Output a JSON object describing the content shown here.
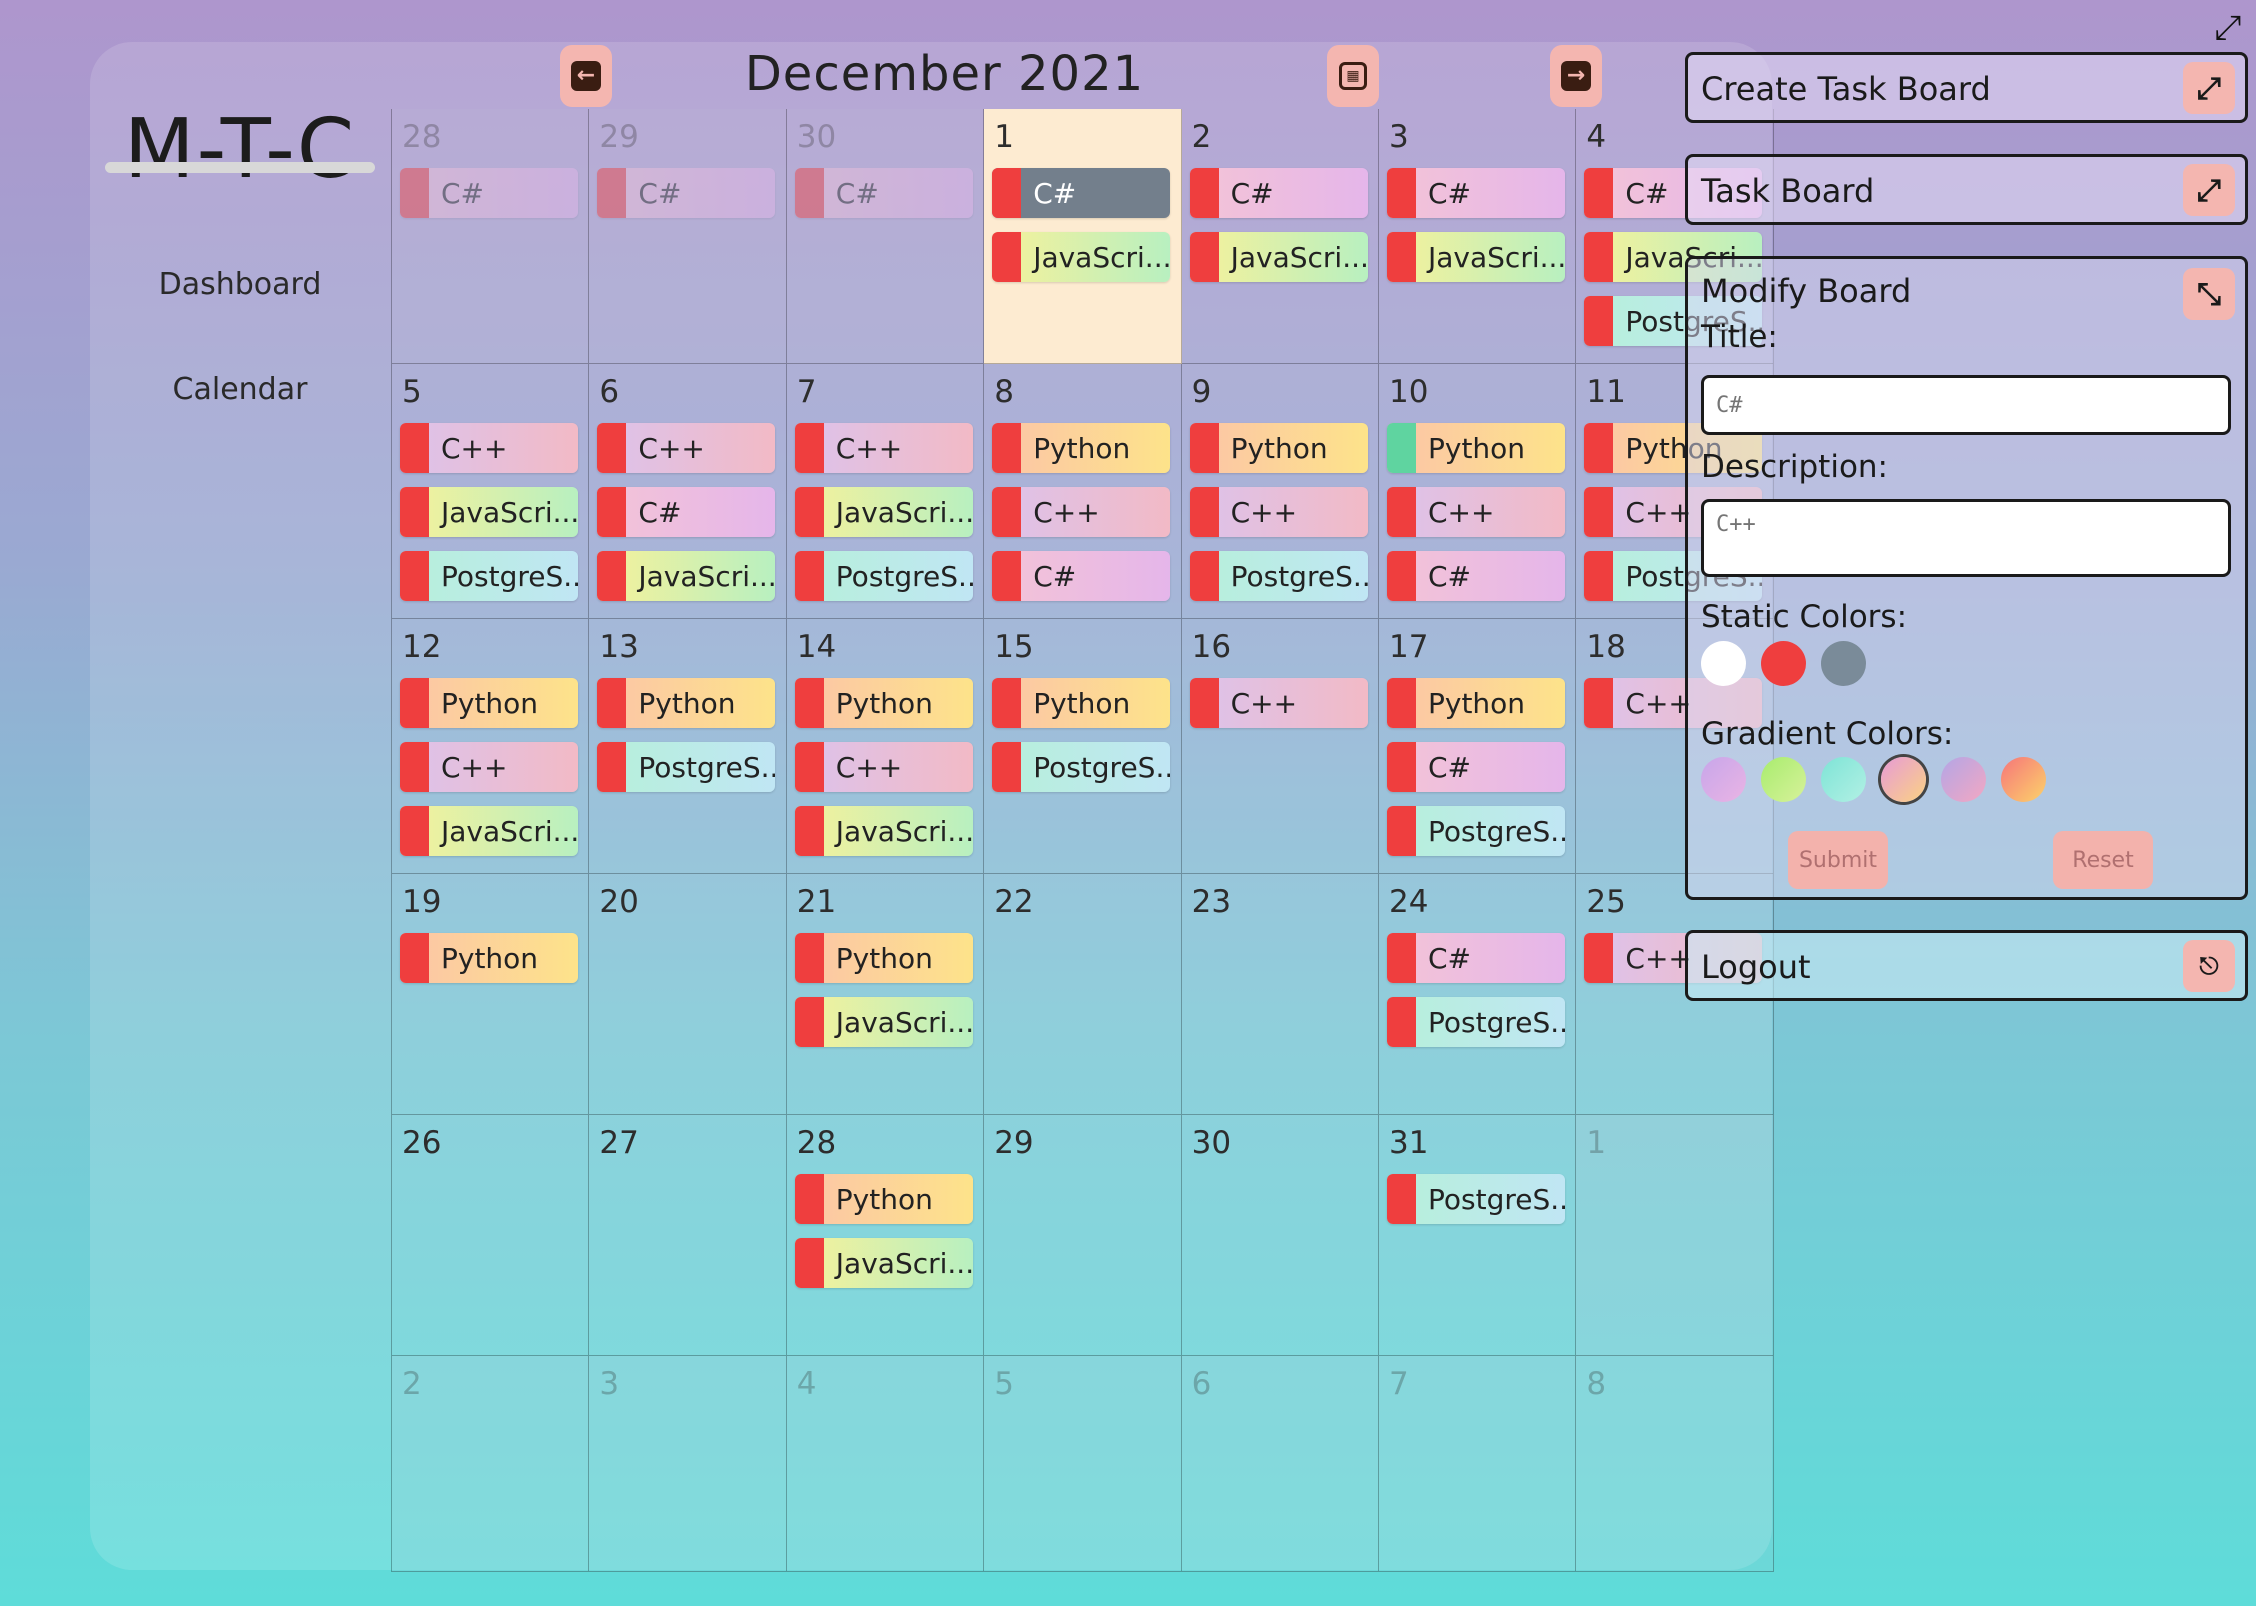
{
  "app": {
    "logo": "M-T-C"
  },
  "nav": {
    "dashboard": "Dashboard",
    "calendar": "Calendar"
  },
  "header": {
    "month": "December 2021",
    "prev_icon": "arrow-left-icon",
    "today_icon": "calendar-icon",
    "next_icon": "arrow-right-icon"
  },
  "colors": {
    "red": "#ef3e3e",
    "green": "#5fd4a0",
    "csharp": "#e7b6e4",
    "javascript": "#c9f0a6",
    "postgres": "#a9ece6",
    "cpp": "#ecc0d4",
    "python": "#fcd98f",
    "today": "#fdebd1",
    "selected": "#737f8c"
  },
  "calendar": {
    "weeks": [
      [
        {
          "day": "28",
          "faded": true,
          "events": [
            {
              "label": "C#",
              "type": "csharp"
            }
          ]
        },
        {
          "day": "29",
          "faded": true,
          "events": [
            {
              "label": "C#",
              "type": "csharp"
            }
          ]
        },
        {
          "day": "30",
          "faded": true,
          "events": [
            {
              "label": "C#",
              "type": "csharp"
            }
          ]
        },
        {
          "day": "1",
          "today": true,
          "events": [
            {
              "label": "C#",
              "type": "selected"
            },
            {
              "label": "JavaScri...",
              "type": "javascript"
            }
          ]
        },
        {
          "day": "2",
          "events": [
            {
              "label": "C#",
              "type": "csharp"
            },
            {
              "label": "JavaScri...",
              "type": "javascript"
            }
          ]
        },
        {
          "day": "3",
          "events": [
            {
              "label": "C#",
              "type": "csharp"
            },
            {
              "label": "JavaScri...",
              "type": "javascript"
            }
          ]
        },
        {
          "day": "4",
          "events": [
            {
              "label": "C#",
              "type": "csharp"
            },
            {
              "label": "JavaScri...",
              "type": "javascript"
            },
            {
              "label": "PostgreS...",
              "type": "postgres"
            }
          ]
        }
      ],
      [
        {
          "day": "5",
          "events": [
            {
              "label": "C++",
              "type": "cpp"
            },
            {
              "label": "JavaScri...",
              "type": "javascript"
            },
            {
              "label": "PostgreS...",
              "type": "postgres"
            }
          ]
        },
        {
          "day": "6",
          "events": [
            {
              "label": "C++",
              "type": "cpp"
            },
            {
              "label": "C#",
              "type": "csharp"
            },
            {
              "label": "JavaScri...",
              "type": "javascript"
            }
          ]
        },
        {
          "day": "7",
          "events": [
            {
              "label": "C++",
              "type": "cpp"
            },
            {
              "label": "JavaScri...",
              "type": "javascript"
            },
            {
              "label": "PostgreS...",
              "type": "postgres"
            }
          ]
        },
        {
          "day": "8",
          "events": [
            {
              "label": "Python",
              "type": "python"
            },
            {
              "label": "C++",
              "type": "cpp"
            },
            {
              "label": "C#",
              "type": "csharp"
            }
          ]
        },
        {
          "day": "9",
          "events": [
            {
              "label": "Python",
              "type": "python"
            },
            {
              "label": "C++",
              "type": "cpp"
            },
            {
              "label": "PostgreS...",
              "type": "postgres"
            }
          ]
        },
        {
          "day": "10",
          "events": [
            {
              "label": "Python",
              "type": "python",
              "bar": "green"
            },
            {
              "label": "C++",
              "type": "cpp"
            },
            {
              "label": "C#",
              "type": "csharp"
            }
          ]
        },
        {
          "day": "11",
          "events": [
            {
              "label": "Python",
              "type": "python"
            },
            {
              "label": "C++",
              "type": "cpp"
            },
            {
              "label": "PostgreS...",
              "type": "postgres"
            }
          ]
        }
      ],
      [
        {
          "day": "12",
          "events": [
            {
              "label": "Python",
              "type": "python"
            },
            {
              "label": "C++",
              "type": "cpp"
            },
            {
              "label": "JavaScri...",
              "type": "javascript"
            }
          ]
        },
        {
          "day": "13",
          "events": [
            {
              "label": "Python",
              "type": "python"
            },
            {
              "label": "PostgreS...",
              "type": "postgres"
            }
          ]
        },
        {
          "day": "14",
          "events": [
            {
              "label": "Python",
              "type": "python"
            },
            {
              "label": "C++",
              "type": "cpp"
            },
            {
              "label": "JavaScri...",
              "type": "javascript"
            }
          ]
        },
        {
          "day": "15",
          "events": [
            {
              "label": "Python",
              "type": "python"
            },
            {
              "label": "PostgreS...",
              "type": "postgres"
            }
          ]
        },
        {
          "day": "16",
          "events": [
            {
              "label": "C++",
              "type": "cpp"
            }
          ]
        },
        {
          "day": "17",
          "events": [
            {
              "label": "Python",
              "type": "python"
            },
            {
              "label": "C#",
              "type": "csharp"
            },
            {
              "label": "PostgreS...",
              "type": "postgres"
            }
          ]
        },
        {
          "day": "18",
          "events": [
            {
              "label": "C++",
              "type": "cpp"
            }
          ]
        }
      ],
      [
        {
          "day": "19",
          "events": [
            {
              "label": "Python",
              "type": "python"
            }
          ]
        },
        {
          "day": "20",
          "events": []
        },
        {
          "day": "21",
          "events": [
            {
              "label": "Python",
              "type": "python"
            },
            {
              "label": "JavaScri...",
              "type": "javascript"
            }
          ]
        },
        {
          "day": "22",
          "events": []
        },
        {
          "day": "23",
          "events": []
        },
        {
          "day": "24",
          "events": [
            {
              "label": "C#",
              "type": "csharp"
            },
            {
              "label": "PostgreS...",
              "type": "postgres"
            }
          ]
        },
        {
          "day": "25",
          "events": [
            {
              "label": "C++",
              "type": "cpp"
            }
          ]
        }
      ],
      [
        {
          "day": "26",
          "events": []
        },
        {
          "day": "27",
          "events": []
        },
        {
          "day": "28",
          "events": [
            {
              "label": "Python",
              "type": "python"
            },
            {
              "label": "JavaScri...",
              "type": "javascript"
            }
          ]
        },
        {
          "day": "29",
          "events": []
        },
        {
          "day": "30",
          "events": []
        },
        {
          "day": "31",
          "events": [
            {
              "label": "PostgreS...",
              "type": "postgres"
            }
          ]
        },
        {
          "day": "1",
          "faded": true,
          "events": []
        }
      ],
      [
        {
          "day": "2",
          "faded": true,
          "events": []
        },
        {
          "day": "3",
          "faded": true,
          "events": []
        },
        {
          "day": "4",
          "faded": true,
          "events": []
        },
        {
          "day": "5",
          "faded": true,
          "events": []
        },
        {
          "day": "6",
          "faded": true,
          "events": []
        },
        {
          "day": "7",
          "faded": true,
          "events": []
        },
        {
          "day": "8",
          "faded": true,
          "events": []
        }
      ]
    ]
  },
  "panels": {
    "create": {
      "title": "Create Task Board",
      "icon": "expand-icon"
    },
    "taskboard": {
      "title": "Task Board",
      "icon": "expand-icon"
    },
    "modify": {
      "title": "Modify Board",
      "icon": "collapse-icon",
      "title_label": "Title:",
      "title_placeholder": "C#",
      "description_label": "Description:",
      "description_placeholder": "C++",
      "static_label": "Static Colors:",
      "static_colors": [
        "#ffffff",
        "#ef3e3e",
        "#7a8b99"
      ],
      "gradient_label": "Gradient Colors:",
      "gradient_colors": [
        [
          "#c7a6ea",
          "#eab4e4"
        ],
        [
          "#a8ec6e",
          "#d7f29a"
        ],
        [
          "#7ee4d6",
          "#b2f0e4"
        ],
        [
          "#e79bd6",
          "#fbd283"
        ],
        [
          "#b3a6e6",
          "#f3a7c2"
        ],
        [
          "#f6757a",
          "#fcd36a"
        ]
      ],
      "submit": "Submit",
      "reset": "Reset"
    },
    "logout": {
      "title": "Logout",
      "icon": "logout-icon"
    }
  }
}
